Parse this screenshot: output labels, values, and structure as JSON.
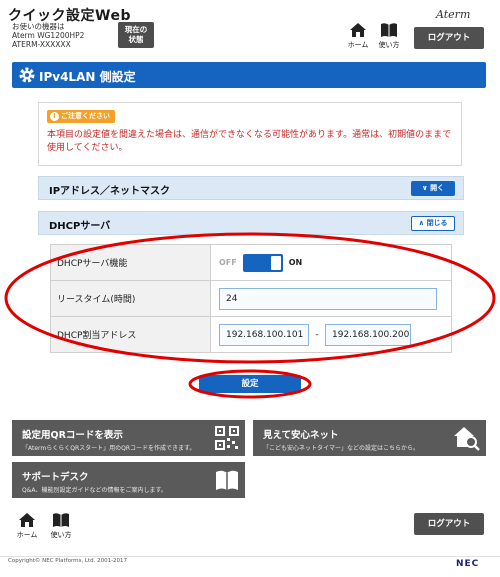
{
  "header": {
    "app_title": "クイック設定Web",
    "device_caption": "お使いの機器は",
    "device_model": "Aterm WG1200HP2",
    "device_serial": "ATERM-XXXXXX",
    "status_button": "現在の\n状態",
    "brand": "Aterm",
    "home_label": "ホーム",
    "help_label": "使い方",
    "logout_label": "ログアウト"
  },
  "section": {
    "title": "IPv4LAN 側設定"
  },
  "caution": {
    "tag": "ご注意ください",
    "text": "本項目の設定値を間違えた場合は、通信ができなくなる可能性があります。通常は、初期値のままで使用してください。"
  },
  "accordions": [
    {
      "title": "IPアドレス／ネットマスク",
      "button": "開く"
    },
    {
      "title": "DHCPサーバ",
      "button": "閉じる"
    }
  ],
  "settings": {
    "dhcp_function_label": "DHCPサーバ機能",
    "toggle_off": "OFF",
    "toggle_on": "ON",
    "lease_label": "リースタイム(時間)",
    "lease_value": "24",
    "range_label": "DHCP割当アドレス",
    "range_start": "192.168.100.101",
    "range_separator": "-",
    "range_end": "192.168.100.200"
  },
  "submit_label": "設定",
  "tiles": [
    {
      "title": "設定用QRコードを表示",
      "desc": "「AtermらくらくQRスタート」用のQRコードを作成できます。"
    },
    {
      "title": "見えて安心ネット",
      "desc": "「こども安心ネットタイマー」などの設定はこちらから。"
    },
    {
      "title": "サポートデスク",
      "desc": "Q&A、機能別設定ガイドなどの情報をご案内します。"
    }
  ],
  "footer": {
    "home_label": "ホーム",
    "help_label": "使い方",
    "logout_label": "ログアウト",
    "copyright": "Copyright© NEC Platforms, Ltd. 2001-2017",
    "logo": "NEC"
  },
  "colors": {
    "accent": "#1565c0",
    "caution_text": "#c62828",
    "caution_tag": "#f3a128",
    "tile_bg": "#5a5a5a",
    "annotation": "#e00000"
  }
}
